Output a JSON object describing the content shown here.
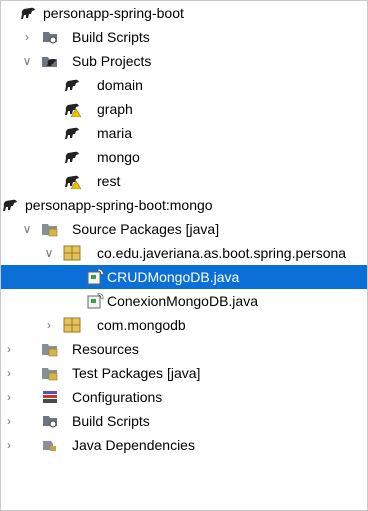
{
  "colors": {
    "selection": "#0a6fd6",
    "package_gold": "#d9b44a",
    "warning_yellow": "#f2c200",
    "project_dark": "#222222"
  },
  "tree": {
    "items": [
      {
        "label": "personapp-spring-boot",
        "icon": "project-icon",
        "expanded": true
      },
      {
        "label": "Build Scripts",
        "icon": "build-scripts-icon",
        "expanded": false
      },
      {
        "label": "Sub Projects",
        "icon": "subprojects-icon",
        "expanded": true
      },
      {
        "label": "domain",
        "icon": "project-icon"
      },
      {
        "label": "graph",
        "icon": "project-warning-icon"
      },
      {
        "label": "maria",
        "icon": "project-icon"
      },
      {
        "label": "mongo",
        "icon": "project-icon"
      },
      {
        "label": "rest",
        "icon": "project-warning-icon"
      },
      {
        "label": "personapp-spring-boot:mongo",
        "icon": "project-icon",
        "expanded": true
      },
      {
        "label": "Source Packages [java]",
        "icon": "source-packages-icon",
        "expanded": true
      },
      {
        "label": "co.edu.javeriana.as.boot.spring.persona",
        "icon": "package-icon",
        "expanded": true
      },
      {
        "label": "CRUDMongoDB.java",
        "icon": "java-interface-icon",
        "selected": true
      },
      {
        "label": "ConexionMongoDB.java",
        "icon": "java-interface-icon"
      },
      {
        "label": "com.mongodb",
        "icon": "package-icon",
        "expanded": false
      },
      {
        "label": "Resources",
        "icon": "resources-icon",
        "expanded": false
      },
      {
        "label": "Test Packages [java]",
        "icon": "test-packages-icon",
        "expanded": false
      },
      {
        "label": "Configurations",
        "icon": "configurations-icon",
        "expanded": false
      },
      {
        "label": "Build Scripts",
        "icon": "build-scripts-icon",
        "expanded": false
      },
      {
        "label": "Java Dependencies",
        "icon": "java-dependencies-icon",
        "expanded": false
      }
    ]
  }
}
